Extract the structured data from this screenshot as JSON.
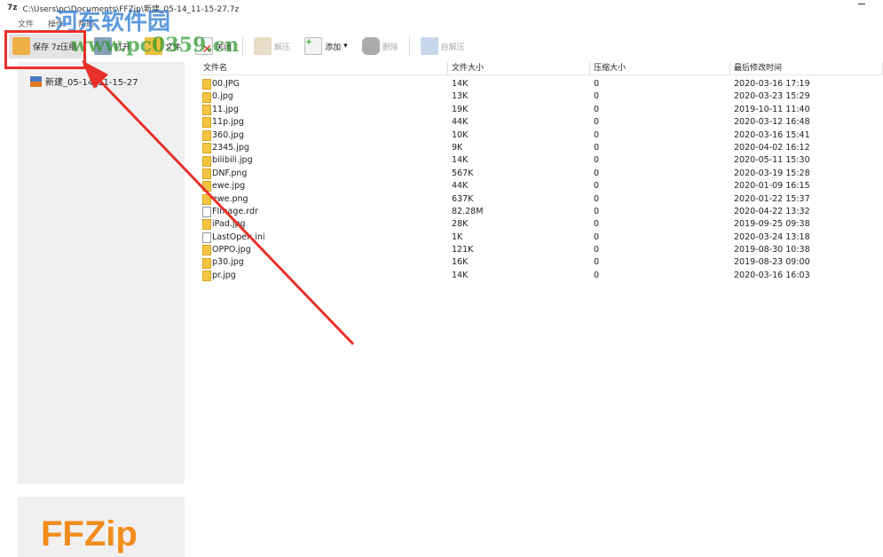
{
  "window": {
    "title": "C:\\Users\\pc\\Documents\\FFZip\\新建_05-14_11-15-27.7z"
  },
  "menu": [
    "文件",
    "操作",
    "帮助"
  ],
  "toolbar": [
    {
      "label": "保存 7z压缩",
      "icon": "save-icon",
      "enabled": true
    },
    {
      "label": "打开",
      "icon": "open-icon",
      "enabled": true
    },
    {
      "label": "文件",
      "icon": "folder-icon",
      "enabled": true
    },
    {
      "label": "关闭",
      "icon": "close-icon",
      "enabled": true
    },
    {
      "label": "解压",
      "icon": "extract-icon",
      "enabled": false
    },
    {
      "label": "添加",
      "icon": "add-icon",
      "enabled": true
    },
    {
      "label": "删除",
      "icon": "delete-icon",
      "enabled": false
    },
    {
      "label": "自解压",
      "icon": "sfx-icon",
      "enabled": false
    }
  ],
  "tree": {
    "root": "新建_05-14_11-15-27"
  },
  "logo": "FFZip",
  "watermark": {
    "cn": "河东软件园",
    "url": "www.pc0359.cn"
  },
  "table": {
    "headers": [
      "文件名",
      "文件大小",
      "压缩大小",
      "最后修改时间"
    ],
    "rows": [
      [
        "00.JPG",
        "14K",
        "0",
        "2020-03-16 17:19"
      ],
      [
        "0.jpg",
        "13K",
        "0",
        "2020-03-23 15:29"
      ],
      [
        "11.jpg",
        "19K",
        "0",
        "2019-10-11 11:40"
      ],
      [
        "11p.jpg",
        "44K",
        "0",
        "2020-03-12 16:48"
      ],
      [
        "360.jpg",
        "10K",
        "0",
        "2020-03-16 15:41"
      ],
      [
        "2345.jpg",
        "9K",
        "0",
        "2020-04-02 16:12"
      ],
      [
        "bilibili.jpg",
        "14K",
        "0",
        "2020-05-11 15:30"
      ],
      [
        "DNF.png",
        "567K",
        "0",
        "2020-03-19 15:28"
      ],
      [
        "ewe.jpg",
        "44K",
        "0",
        "2020-01-09 16:15"
      ],
      [
        "ewe.png",
        "637K",
        "0",
        "2020-01-22 15:37"
      ],
      [
        "FImage.rdr",
        "82.28M",
        "0",
        "2020-04-22 13:32"
      ],
      [
        "iPad.jpg",
        "28K",
        "0",
        "2019-09-25 09:38"
      ],
      [
        "LastOpen.ini",
        "1K",
        "0",
        "2020-03-24 13:18"
      ],
      [
        "OPPO.jpg",
        "121K",
        "0",
        "2019-08-30 10:38"
      ],
      [
        "p30.jpg",
        "16K",
        "0",
        "2019-08-23 09:00"
      ],
      [
        "pr.jpg",
        "14K",
        "0",
        "2020-03-16 16:03"
      ]
    ]
  },
  "colors": {
    "annotation": "#e8302a",
    "logo": "#f28c1c"
  }
}
